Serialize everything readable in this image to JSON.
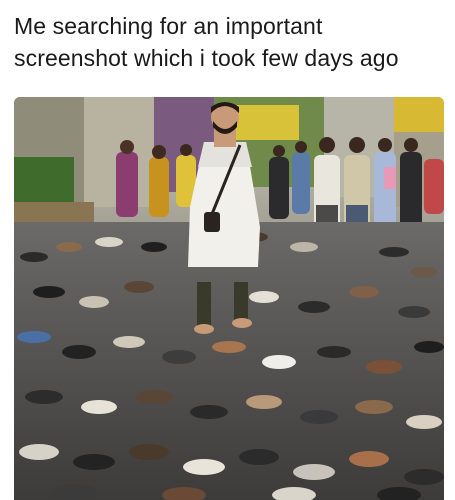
{
  "caption": {
    "line1": "Me searching for an important",
    "line2": "screenshot which i took few days ago"
  },
  "photo": {
    "kind": "photograph",
    "scene": "crowd-with-man-standing-among-pile-of-shoes"
  }
}
